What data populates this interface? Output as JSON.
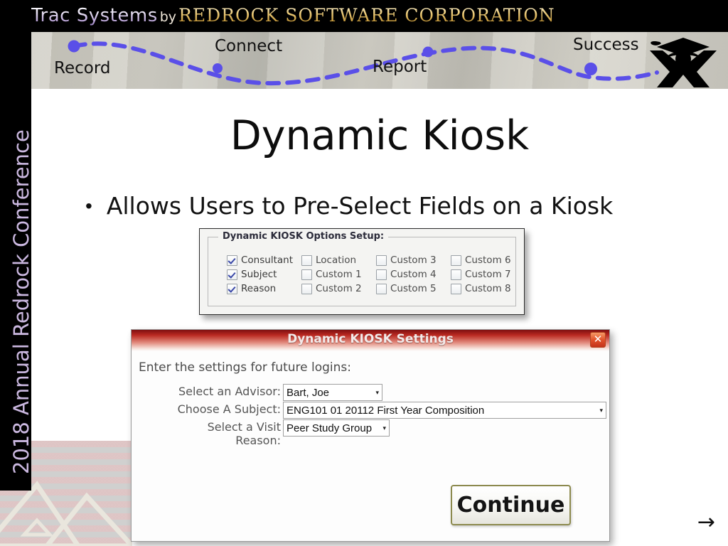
{
  "brand": {
    "logo_primary": "Trac Systems",
    "logo_by": "by",
    "logo_company": "REDROCK SOFTWARE CORPORATION",
    "accent_gold": "#e8c878",
    "accent_purple": "#b9a3d6"
  },
  "sidebar": {
    "conference_label": "2018 Annual Redrock Conference",
    "text_color": "#cbb8e0",
    "background": "#000000"
  },
  "banner": {
    "stages": [
      {
        "label": "Record"
      },
      {
        "label": "Connect"
      },
      {
        "label": "Report"
      },
      {
        "label": "Success"
      }
    ],
    "wave_color": "#5a4fe8",
    "figure_icon": "graduate-figure-icon"
  },
  "slide": {
    "title": "Dynamic Kiosk",
    "bullet_marker": "•",
    "bullets": [
      "Allows Users to Pre-Select Fields on a Kiosk"
    ],
    "next_arrow": "→"
  },
  "options_panel": {
    "legend": "Dynamic KIOSK Options Setup:",
    "checkboxes": [
      {
        "label": "Consultant",
        "checked": true
      },
      {
        "label": "Location",
        "checked": false
      },
      {
        "label": "Custom 3",
        "checked": false
      },
      {
        "label": "Custom 6",
        "checked": false
      },
      {
        "label": "Subject",
        "checked": true
      },
      {
        "label": "Custom 1",
        "checked": false
      },
      {
        "label": "Custom 4",
        "checked": false
      },
      {
        "label": "Custom 7",
        "checked": false
      },
      {
        "label": "Reason",
        "checked": true
      },
      {
        "label": "Custom 2",
        "checked": false
      },
      {
        "label": "Custom 5",
        "checked": false
      },
      {
        "label": "Custom 8",
        "checked": false
      }
    ]
  },
  "dialog": {
    "title": "Dynamic KIOSK Settings",
    "close_label": "✕",
    "intro": "Enter the settings for future logins:",
    "fields": [
      {
        "label": "Select an Advisor:",
        "value": "Bart, Joe"
      },
      {
        "label": "Choose A Subject:",
        "value": "ENG101 01 20112 First Year Composition"
      },
      {
        "label": "Select a Visit Reason:",
        "label_line1": "Select a Visit",
        "label_line2": "Reason:",
        "value": "Peer Study Group"
      }
    ],
    "dropdown_arrow": "▾",
    "continue_label": "Continue",
    "titlebar_color": "#bb2a22",
    "close_color": "#e2522b"
  }
}
